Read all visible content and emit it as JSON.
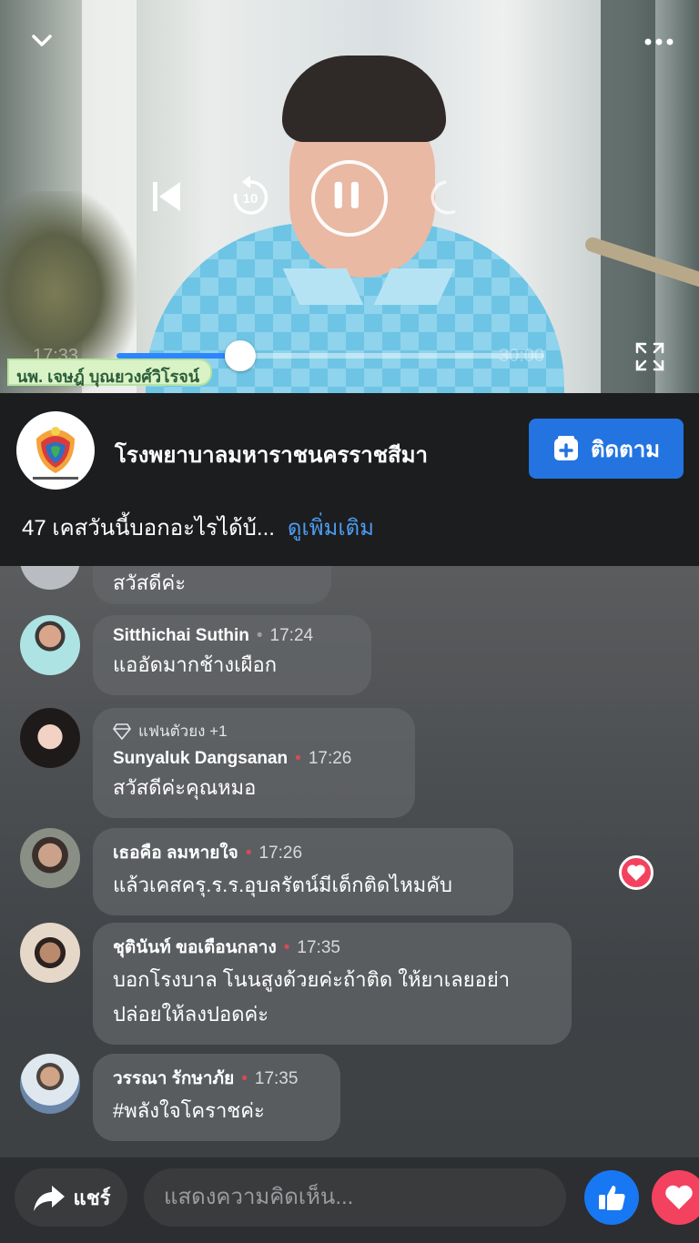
{
  "video": {
    "current_time": "17:33",
    "end_time": "30:00",
    "progress": 0.29,
    "name_banner": "นพ. เจษฎ์ บุณยวงศ์วิโรจน์"
  },
  "page": {
    "name": "โรงพยาบาลมหาราชนครราชสีมา",
    "follow_label": "ติดตาม",
    "description": "47 เคสวันนี้บอกอะไรได้บ้...",
    "see_more": "ดูเพิ่มเติม"
  },
  "comments": [
    {
      "author": "",
      "time": "",
      "text": "สวัสดีค่ะ"
    },
    {
      "author": "Sitthichai Suthin",
      "time": "17:24",
      "text": "แออัดมากช้างเผือก"
    },
    {
      "badge": "แฟนตัวยง +1",
      "author": "Sunyaluk Dangsanan",
      "time": "17:26",
      "text": "สวัสดีค่ะคุณหมอ"
    },
    {
      "author": "เธอคือ ลมหายใจ",
      "time": "17:26",
      "text": "แล้วเคสครุ.ร.ร.อุบลรัตน์มีเด็กติดไหมคับ"
    },
    {
      "author": "ชุตินันท์ ขอเตือนกลาง",
      "time": "17:35",
      "text_line1": "บอกโรงบาล โนนสูงด้วยค่ะถ้าติด ให้ยาเลยอย่า",
      "text_line2": "ปล่อยให้ลงปอดค่ะ"
    },
    {
      "author": "วรรณา รักษาภัย",
      "time": "17:35",
      "text": "#พลังใจโคราชค่ะ"
    }
  ],
  "bottom": {
    "share_label": "แชร์",
    "comment_placeholder": "แสดงความคิดเห็น..."
  },
  "colors": {
    "accent": "#2374e1",
    "love": "#f3425f",
    "progress": "#2d86ff"
  },
  "icons": [
    "chevron-down-icon",
    "more-icon",
    "previous-icon",
    "rewind-10-icon",
    "pause-icon",
    "forward-icon",
    "fullscreen-icon",
    "follow-plus-icon",
    "diamond-icon",
    "heart-icon",
    "share-arrow-icon",
    "like-icon",
    "love-icon"
  ]
}
